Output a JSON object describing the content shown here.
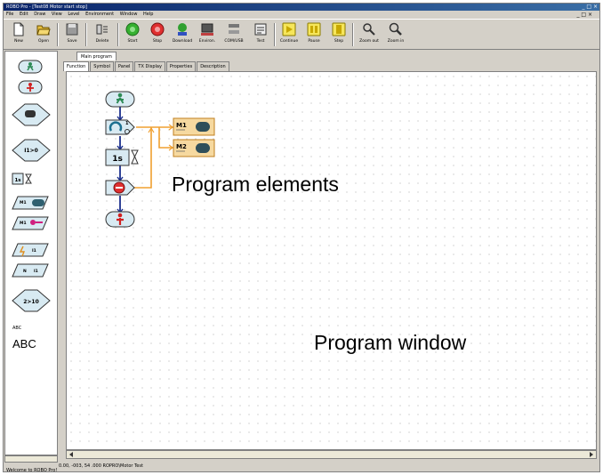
{
  "window": {
    "title": "ROBO Pro - [Test08 Motor start stop]",
    "controls": "_ □ ×",
    "mdi_controls": "_ □ ×"
  },
  "menu": [
    "File",
    "Edit",
    "Draw",
    "View",
    "Level",
    "Environment",
    "Window",
    "Help"
  ],
  "toolbar": [
    {
      "label": "New",
      "icon": "new-page-icon"
    },
    {
      "label": "Open",
      "icon": "open-folder-icon"
    },
    {
      "label": "Save",
      "icon": "save-disk-icon"
    },
    {
      "label": "Delete",
      "icon": "delete-icon"
    },
    {
      "label": "Start",
      "icon": "start-icon"
    },
    {
      "label": "Stop",
      "icon": "stop-icon"
    },
    {
      "label": "Download",
      "icon": "download-icon"
    },
    {
      "label": "Environ.",
      "icon": "environment-icon"
    },
    {
      "label": "COM/USB",
      "icon": "com-usb-icon"
    },
    {
      "label": "Test",
      "icon": "test-icon"
    },
    {
      "label": "Continue",
      "icon": "continue-icon"
    },
    {
      "label": "Pause",
      "icon": "pause-icon"
    },
    {
      "label": "Step",
      "icon": "step-icon"
    },
    {
      "label": "Zoom out",
      "icon": "zoom-out-icon"
    },
    {
      "label": "Zoom in",
      "icon": "zoom-in-icon"
    }
  ],
  "program_tab": "Main program",
  "tabs": [
    "Function",
    "Symbol",
    "Panel",
    "TX Display",
    "Properties",
    "Description"
  ],
  "palette": {
    "abc_small": "ABC",
    "abc_large": "ABC",
    "wait_label": "1s",
    "branch_label": "I1>0",
    "compare_label": "2>10"
  },
  "flow": {
    "wait_label": "1s",
    "m1_label": "M1",
    "m2_label": "M2",
    "counter_label": "1"
  },
  "captions": {
    "elements": "Program elements",
    "window": "Program window"
  },
  "status": {
    "coords": "0.00, -003, 54 .000  ROPRO\\Motor Test",
    "welcome": "Welcome to ROBO Pro!"
  },
  "colors": {
    "start_green": "#2e8b57",
    "stop_red": "#d02020",
    "motor_orange": "#f0a030",
    "flow_blue": "#1c2f8c",
    "block_fill": "#d8eaf2"
  }
}
